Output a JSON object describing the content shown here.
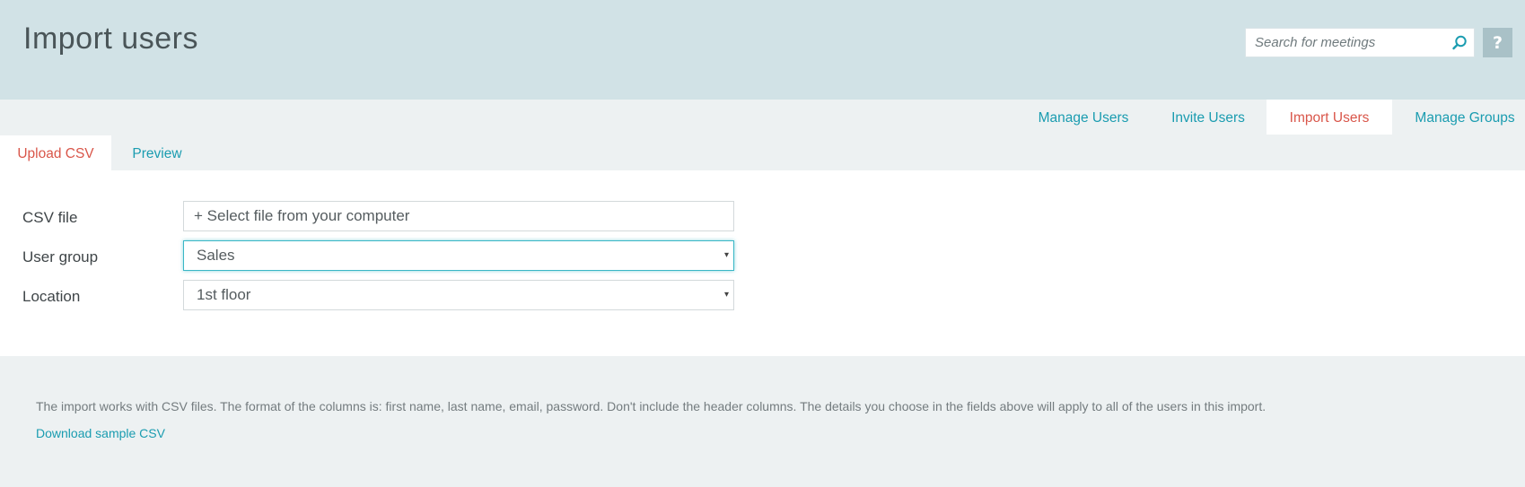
{
  "header": {
    "title": "Import users",
    "search_placeholder": "Search for meetings",
    "search_icon": "search-icon",
    "help_label": "?"
  },
  "main_nav": {
    "tabs": [
      {
        "label": "Manage Users",
        "active": false
      },
      {
        "label": "Invite Users",
        "active": false
      },
      {
        "label": "Import Users",
        "active": true
      },
      {
        "label": "Manage Groups",
        "active": false
      }
    ]
  },
  "sub_nav": {
    "tabs": [
      {
        "label": "Upload CSV",
        "active": true
      },
      {
        "label": "Preview",
        "active": false
      }
    ]
  },
  "form": {
    "csv_file": {
      "label": "CSV file",
      "button_text": "+ Select file from your computer"
    },
    "user_group": {
      "label": "User group",
      "value": "Sales"
    },
    "location": {
      "label": "Location",
      "value": "1st floor"
    },
    "select_arrow": "▾"
  },
  "info": {
    "text": "The import works with CSV files. The format of the columns is: first name, last name, email, password. Don't include the header columns. The details you choose in the fields above will apply to all of the users in this import.",
    "download_link": "Download sample CSV"
  },
  "colors": {
    "header_bg": "#d1e2e6",
    "link": "#1a9cb0",
    "active_tab": "#d9564a",
    "focus_border": "#3ab7c6"
  }
}
